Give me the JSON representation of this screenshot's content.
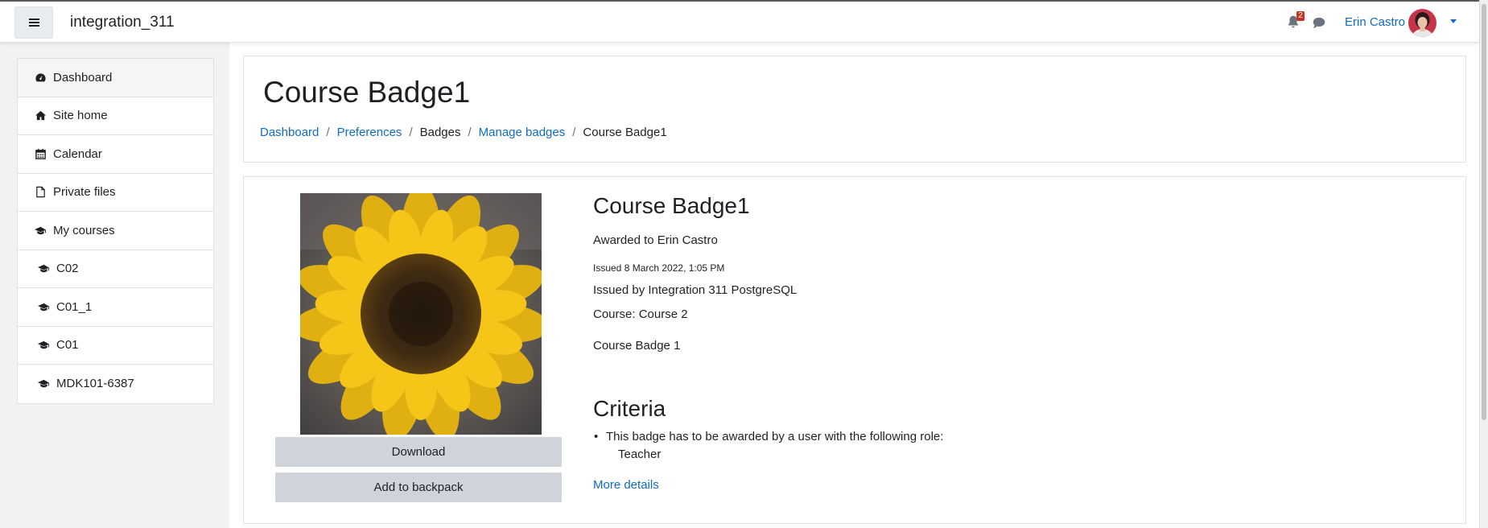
{
  "navbar": {
    "site_name": "integration_311",
    "notification_count": "2",
    "user_name": "Erin Castro"
  },
  "drawer": {
    "items": [
      {
        "label": "Dashboard",
        "icon": "dashboard-icon"
      },
      {
        "label": "Site home",
        "icon": "home-icon"
      },
      {
        "label": "Calendar",
        "icon": "calendar-icon"
      },
      {
        "label": "Private files",
        "icon": "file-icon"
      },
      {
        "label": "My courses",
        "icon": "graduation-cap-icon"
      },
      {
        "label": "C02",
        "icon": "graduation-cap-icon"
      },
      {
        "label": "C01_1",
        "icon": "graduation-cap-icon"
      },
      {
        "label": "C01",
        "icon": "graduation-cap-icon"
      },
      {
        "label": "MDK101-6387",
        "icon": "graduation-cap-icon"
      }
    ]
  },
  "header": {
    "title": "Course Badge1",
    "breadcrumb": [
      "Dashboard",
      "Preferences",
      "Badges",
      "Manage badges",
      "Course Badge1"
    ]
  },
  "badge": {
    "title": "Course Badge1",
    "awarded_to": "Awarded to Erin Castro",
    "issued": "Issued 8 March 2022, 1:05 PM",
    "issued_by": "Issued by Integration 311 PostgreSQL",
    "course": "Course: Course 2",
    "description": "Course Badge 1",
    "download_label": "Download",
    "backpack_label": "Add to backpack",
    "criteria_heading": "Criteria",
    "criteria_text": "This badge has to be awarded by a user with the following role:",
    "criteria_role": "Teacher",
    "more_details": "More details"
  },
  "colors": {
    "link": "#0f6cbf",
    "button_bg": "#ced4da",
    "notification_badge": "#ca3120"
  }
}
